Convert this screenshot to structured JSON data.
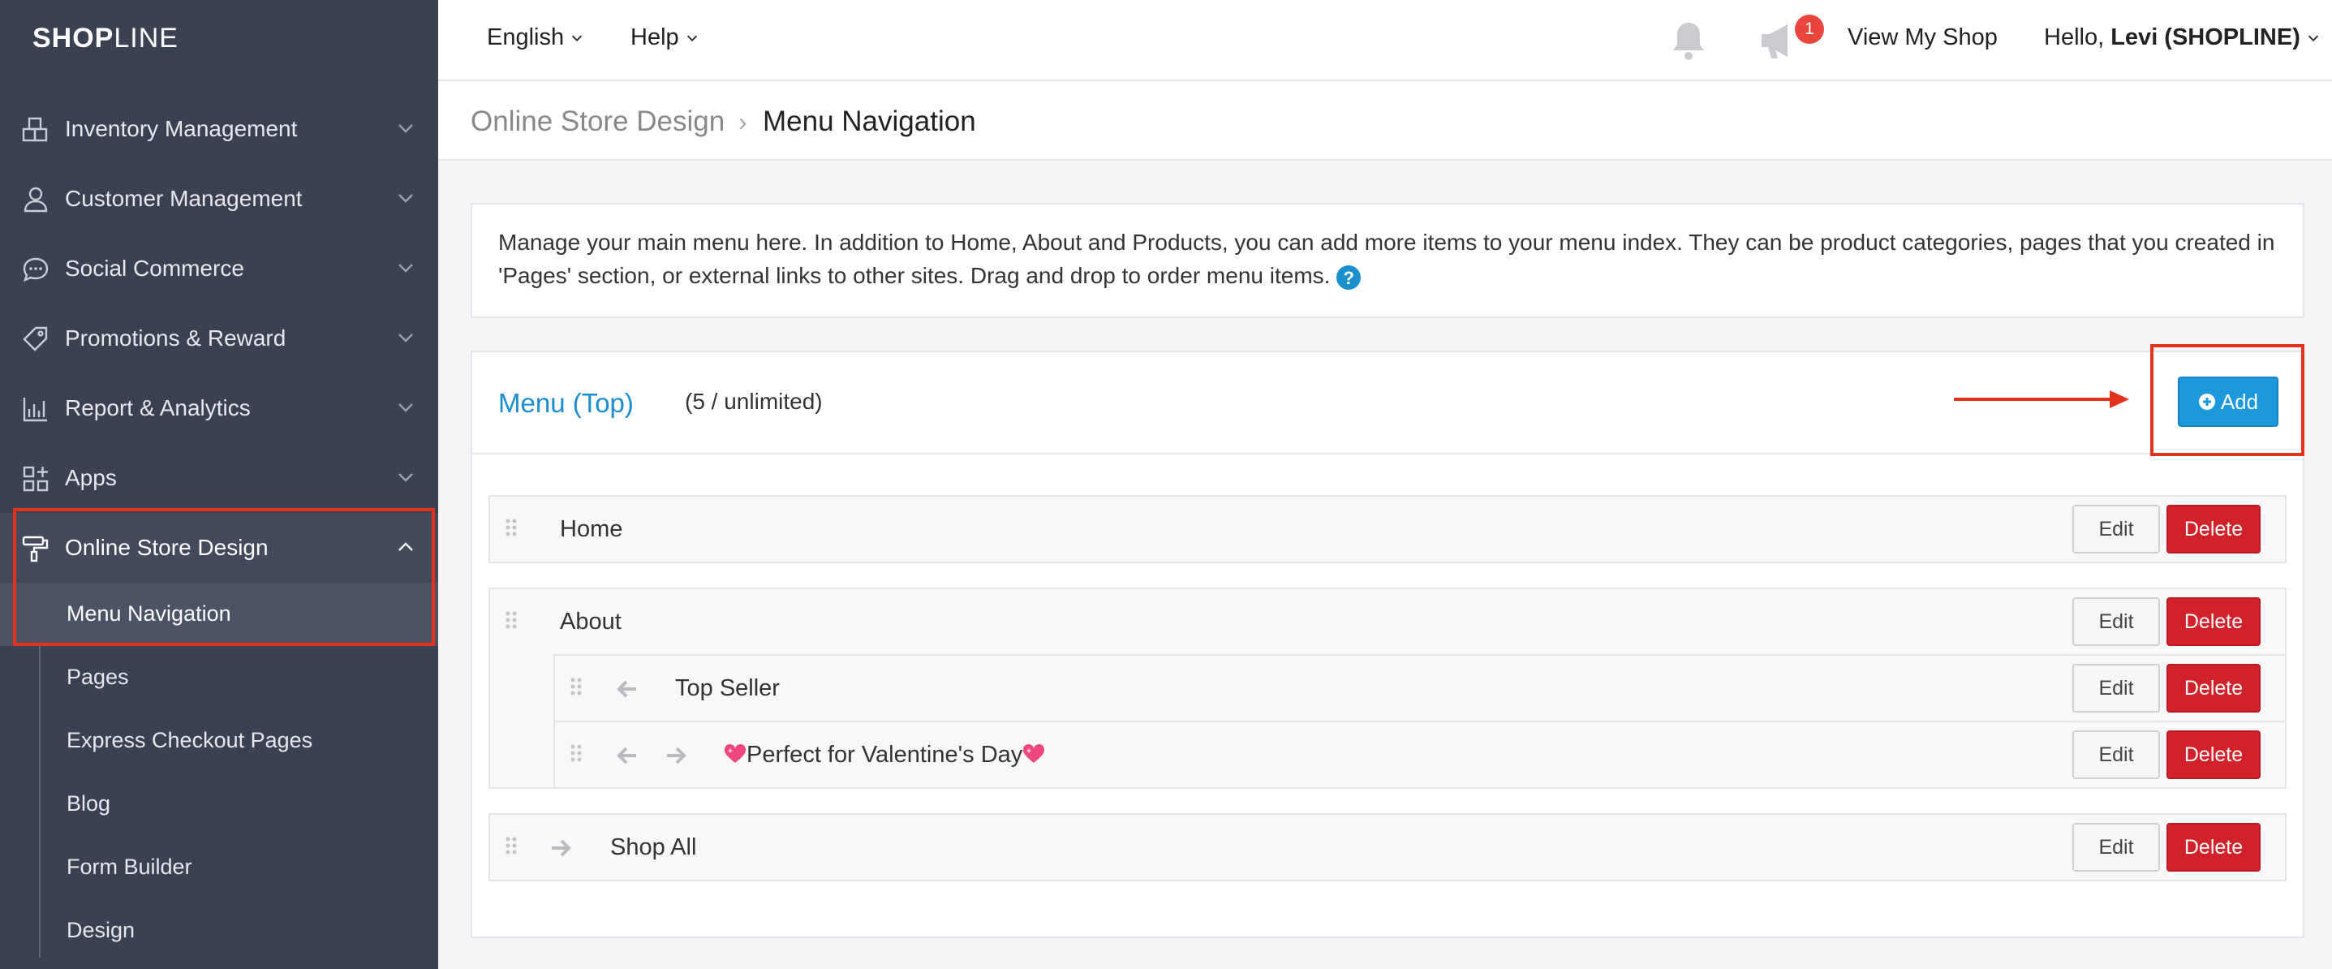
{
  "brand": {
    "name_bold": "SHOP",
    "name_thin": "LINE"
  },
  "sidebar": {
    "items": [
      {
        "label": "Inventory Management",
        "icon": "boxes-icon"
      },
      {
        "label": "Customer Management",
        "icon": "user-icon"
      },
      {
        "label": "Social Commerce",
        "icon": "chat-icon"
      },
      {
        "label": "Promotions & Reward",
        "icon": "tag-icon"
      },
      {
        "label": "Report & Analytics",
        "icon": "chart-icon"
      },
      {
        "label": "Apps",
        "icon": "apps-grid-icon"
      },
      {
        "label": "Online Store Design",
        "icon": "paint-roller-icon",
        "expanded": true
      }
    ],
    "subitems": [
      {
        "label": "Menu Navigation",
        "active": true
      },
      {
        "label": "Pages"
      },
      {
        "label": "Express Checkout Pages"
      },
      {
        "label": "Blog"
      },
      {
        "label": "Form Builder"
      },
      {
        "label": "Design"
      }
    ]
  },
  "topbar": {
    "language": "English",
    "help": "Help",
    "notification_count": "1",
    "view_shop": "View My Shop",
    "greeting": "Hello,",
    "user": "Levi (SHOPLINE)"
  },
  "breadcrumb": {
    "parent": "Online Store Design",
    "current": "Menu Navigation"
  },
  "description": "Manage your main menu here. In addition to Home, About and Products, you can add more items to your menu index. They can be product categories, pages that you created in 'Pages' section, or external links to other sites. Drag and drop to order menu items.",
  "menu": {
    "title": "Menu (Top)",
    "count": "(5 / unlimited)",
    "add_label": "Add",
    "edit_label": "Edit",
    "delete_label": "Delete",
    "items": [
      {
        "label": "Home"
      },
      {
        "label": "About"
      },
      {
        "label": "Top Seller"
      },
      {
        "label": "Perfect for Valentine's Day",
        "emoji": "💖"
      },
      {
        "label": "Shop All"
      }
    ]
  },
  "colors": {
    "accent": "#1c98dd",
    "danger": "#d1222b",
    "highlight": "#e0321d",
    "sidebar": "#3a4153"
  }
}
